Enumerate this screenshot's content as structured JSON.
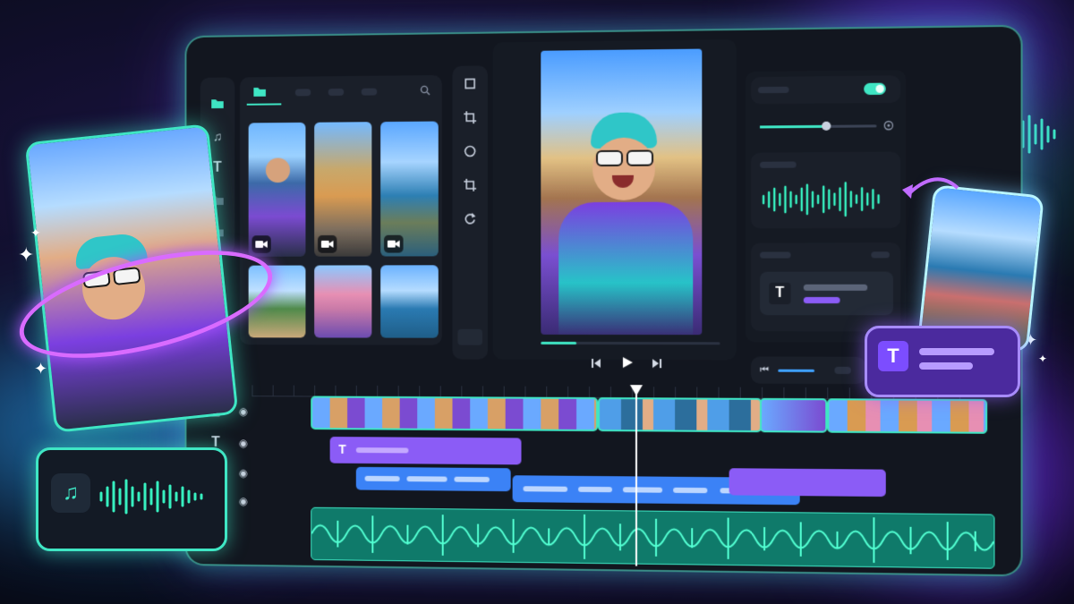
{
  "colors": {
    "accent_teal": "#3fe6c4",
    "accent_purple": "#8b5cf6",
    "accent_blue": "#3b82f6",
    "panel_bg": "#1a1f29"
  },
  "media_library": {
    "tabs": [
      "media-icon",
      "tab-2",
      "tab-3",
      "tab-4"
    ],
    "search_icon": "search-icon",
    "side_icons": [
      "folder-icon",
      "music-icon",
      "text-icon",
      "folder-icon",
      "folder-icon"
    ],
    "thumbnails": [
      {
        "kind": "video",
        "subject": "selfie-girl-street"
      },
      {
        "kind": "video",
        "subject": "city-street"
      },
      {
        "kind": "video",
        "subject": "coast-rock"
      },
      {
        "kind": "image",
        "subject": "palm-building"
      },
      {
        "kind": "image",
        "subject": "pink-building-girl"
      },
      {
        "kind": "image",
        "subject": "coastline"
      }
    ]
  },
  "tools": [
    "select-icon",
    "crop-icon",
    "circle-icon",
    "transform-icon",
    "rotate-icon"
  ],
  "preview": {
    "subject": "smiling-girl-selfie-peace-sign",
    "progress": 0.2,
    "controls": [
      "skip-back-icon",
      "play-icon",
      "skip-forward-icon"
    ]
  },
  "properties": {
    "toggle_on": true,
    "slider_value": 0.55,
    "text_layer_icon": "T"
  },
  "timeline": {
    "track_icons": [
      "video-icon",
      "text-icon",
      "subtitle-icon",
      "music-icon"
    ],
    "playhead_position": 0.48
  },
  "floating": {
    "text_card_icon": "T",
    "music_card_icon": "music-icon"
  }
}
